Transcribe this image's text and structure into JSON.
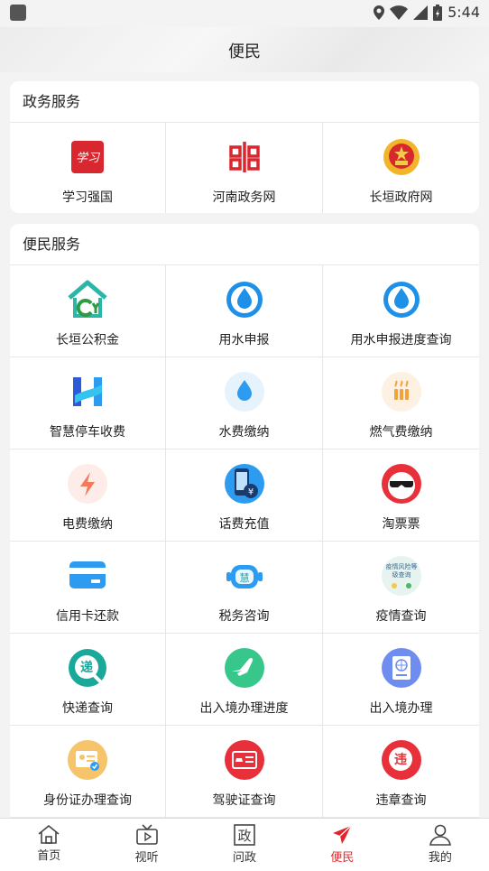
{
  "status": {
    "time": "5:44"
  },
  "header": {
    "title": "便民"
  },
  "gov": {
    "title": "政务服务",
    "items": [
      {
        "label": "学习强国",
        "icon_text": "学习"
      },
      {
        "label": "河南政务网"
      },
      {
        "label": "长垣政府网"
      }
    ]
  },
  "civic": {
    "title": "便民服务",
    "items": [
      {
        "label": "长垣公积金"
      },
      {
        "label": "用水申报"
      },
      {
        "label": "用水申报进度查询"
      },
      {
        "label": "智慧停车收费"
      },
      {
        "label": "水费缴纳"
      },
      {
        "label": "燃气费缴纳"
      },
      {
        "label": "电费缴纳"
      },
      {
        "label": "话费充值",
        "icon_text": "¥"
      },
      {
        "label": "淘票票"
      },
      {
        "label": "信用卡还款"
      },
      {
        "label": "税务咨询",
        "icon_text": "慧"
      },
      {
        "label": "疫情查询",
        "icon_text": "疫情风险等级查询"
      },
      {
        "label": "快递查询",
        "icon_text": "递"
      },
      {
        "label": "出入境办理进度"
      },
      {
        "label": "出入境办理"
      },
      {
        "label": "身份证办理查询"
      },
      {
        "label": "驾驶证查询"
      },
      {
        "label": "违章查询",
        "icon_text": "违"
      }
    ]
  },
  "tabbar": {
    "items": [
      {
        "label": "首页"
      },
      {
        "label": "视听"
      },
      {
        "label": "问政",
        "icon_text": "政"
      },
      {
        "label": "便民"
      },
      {
        "label": "我的"
      }
    ],
    "active": "便民"
  },
  "colors": {
    "accent": "#e0262c",
    "blue": "#2d9cf0",
    "teal": "#2bb6a8"
  }
}
